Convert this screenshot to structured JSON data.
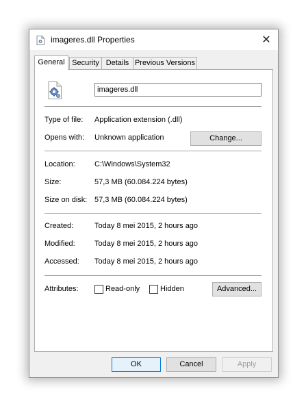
{
  "window": {
    "title": "imageres.dll Properties",
    "close_glyph": "✕"
  },
  "tabs": [
    {
      "label": "General",
      "active": true
    },
    {
      "label": "Security",
      "active": false
    },
    {
      "label": "Details",
      "active": false
    },
    {
      "label": "Previous Versions",
      "active": false
    }
  ],
  "general": {
    "file_name": "imageres.dll",
    "type_label": "Type of file:",
    "type_value": "Application extension (.dll)",
    "opens_label": "Opens with:",
    "opens_value": "Unknown application",
    "change_button": "Change...",
    "location_label": "Location:",
    "location_value": "C:\\Windows\\System32",
    "size_label": "Size:",
    "size_value": "57,3 MB (60.084.224 bytes)",
    "size_disk_label": "Size on disk:",
    "size_disk_value": "57,3 MB (60.084.224 bytes)",
    "created_label": "Created:",
    "created_value": "Today 8 mei 2015, 2 hours ago",
    "modified_label": "Modified:",
    "modified_value": "Today 8 mei 2015, 2 hours ago",
    "accessed_label": "Accessed:",
    "accessed_value": "Today 8 mei 2015, 2 hours ago",
    "attributes_label": "Attributes:",
    "readonly_label": "Read-only",
    "readonly_checked": false,
    "hidden_label": "Hidden",
    "hidden_checked": false,
    "advanced_button": "Advanced..."
  },
  "footer": {
    "ok": "OK",
    "cancel": "Cancel",
    "apply": "Apply"
  },
  "icons": {
    "title_icon": "dll-file-icon",
    "file_icon": "dll-gear-file-icon"
  }
}
